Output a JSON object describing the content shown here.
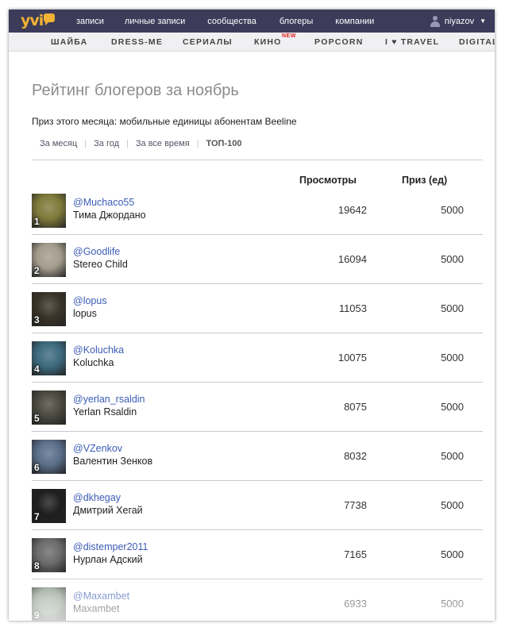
{
  "topnav": {
    "logo": "yvi",
    "items": [
      "записи",
      "личные записи",
      "сообщества",
      "блогеры",
      "компании"
    ],
    "user": "niyazov"
  },
  "subnav": {
    "items": [
      "ШАЙБА",
      "DRESS-ME",
      "СЕРИАЛЫ",
      "КИНО",
      "POPCORN",
      "I ♥ TRAVEL",
      "DIGITAL"
    ],
    "new_badge": "NEW"
  },
  "page": {
    "title": "Рейтинг блогеров за ноябрь",
    "prize_text": "Приз этого месяца: мобильные единицы абонентам Beeline",
    "tabs": [
      "За месяц",
      "За год",
      "За все время",
      "ТОП-100"
    ],
    "columns": {
      "views": "Просмотры",
      "prize": "Приз (ед)"
    }
  },
  "bloggers": [
    {
      "rank": "1",
      "handle": "@Muchaco55",
      "name": "Тима Джордано",
      "views": "19642",
      "prize": "5000",
      "avatar": "#7d7a3a"
    },
    {
      "rank": "2",
      "handle": "@Goodlife",
      "name": "Stereo Child",
      "views": "16094",
      "prize": "5000",
      "avatar": "#a39c8c"
    },
    {
      "rank": "3",
      "handle": "@lopus",
      "name": "lopus",
      "views": "11053",
      "prize": "5000",
      "avatar": "#3a3428"
    },
    {
      "rank": "4",
      "handle": "@Koluchka",
      "name": "Koluchka",
      "views": "10075",
      "prize": "5000",
      "avatar": "#3c6a7e"
    },
    {
      "rank": "5",
      "handle": "@yerlan_rsaldin",
      "name": "Yerlan Rsaldin",
      "views": "8075",
      "prize": "5000",
      "avatar": "#4a4a40"
    },
    {
      "rank": "6",
      "handle": "@VZenkov",
      "name": "Валентин Зенков",
      "views": "8032",
      "prize": "5000",
      "avatar": "#5a6e8a"
    },
    {
      "rank": "7",
      "handle": "@dkhegay",
      "name": "Дмитрий Хегай",
      "views": "7738",
      "prize": "5000",
      "avatar": "#1e1e1e"
    },
    {
      "rank": "8",
      "handle": "@distemper2011",
      "name": "Нурлан Адский",
      "views": "7165",
      "prize": "5000",
      "avatar": "#6a6a6a"
    },
    {
      "rank": "9",
      "handle": "@Maxambet",
      "name": "Maxambet",
      "views": "6933",
      "prize": "5000",
      "avatar": "#8a9a8a"
    }
  ]
}
